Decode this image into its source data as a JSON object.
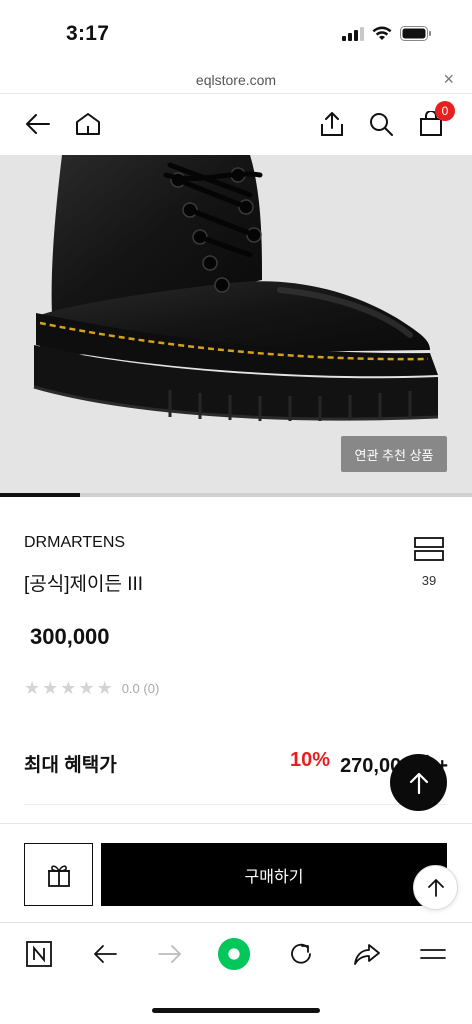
{
  "status_bar": {
    "time": "3:17"
  },
  "browser": {
    "url": "eqlstore.com",
    "close_glyph": "×"
  },
  "header": {
    "icons": [
      "back-arrow-icon",
      "home-icon",
      "share-icon",
      "search-icon",
      "shopping-bag-icon"
    ],
    "cart_count": "0"
  },
  "gallery": {
    "related_button": "연관 추천 상품",
    "progress": 0.17
  },
  "product": {
    "brand": "DRMARTENS",
    "name": "[공식]제이든 III",
    "wish_count": "39",
    "price": "300,000",
    "rating_stars": 0,
    "rating_text": "0.0 (0)"
  },
  "benefit": {
    "label": "최대 혜택가",
    "discount": "10%",
    "price": "270,000원 +"
  },
  "purchase": {
    "buy_label": "구매하기"
  },
  "bottom_nav": {
    "icons": [
      "n-icon",
      "back-icon",
      "forward-icon",
      "green-dot-icon",
      "reload-icon",
      "share-icon",
      "menu-icon"
    ]
  },
  "colors": {
    "accent_red": "#e5201f",
    "badge_red": "#e5201f",
    "naver_green": "#03c75a"
  }
}
